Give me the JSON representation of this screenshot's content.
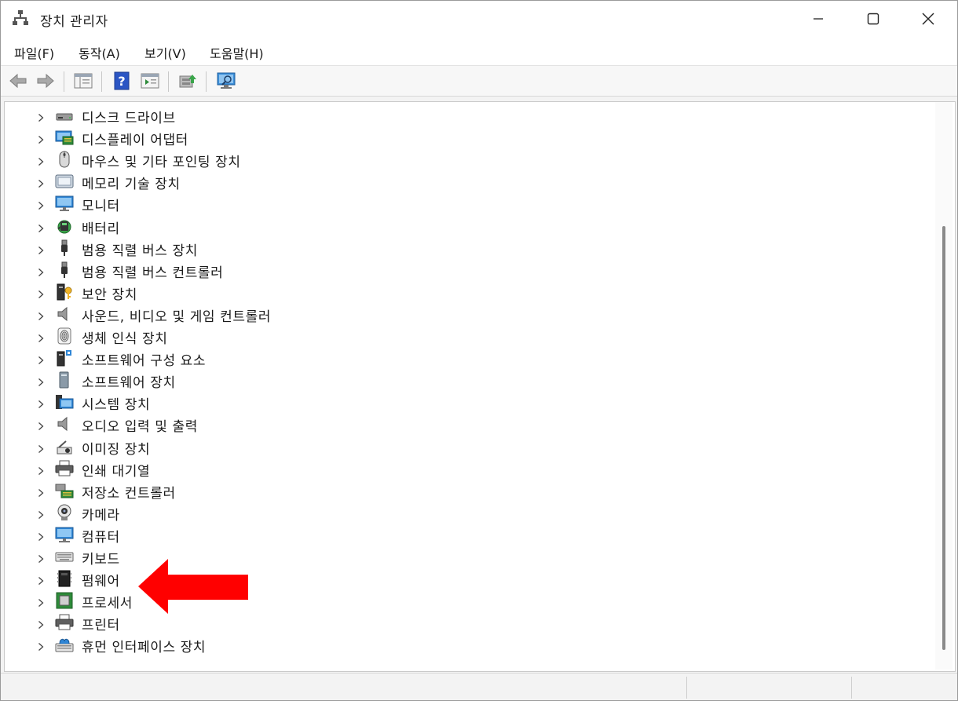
{
  "window": {
    "title": "장치 관리자"
  },
  "menu": [
    "파일(F)",
    "동작(A)",
    "보기(V)",
    "도움말(H)"
  ],
  "tree": [
    {
      "label": "디스크 드라이브",
      "icon": "disk-drive-icon"
    },
    {
      "label": "디스플레이 어댑터",
      "icon": "display-adapter-icon"
    },
    {
      "label": "마우스 및 기타 포인팅 장치",
      "icon": "mouse-icon"
    },
    {
      "label": "메모리 기술 장치",
      "icon": "memory-device-icon"
    },
    {
      "label": "모니터",
      "icon": "monitor-icon"
    },
    {
      "label": "배터리",
      "icon": "battery-icon"
    },
    {
      "label": "범용 직렬 버스 장치",
      "icon": "usb-icon"
    },
    {
      "label": "범용 직렬 버스 컨트롤러",
      "icon": "usb-icon"
    },
    {
      "label": "보안 장치",
      "icon": "security-device-icon"
    },
    {
      "label": "사운드, 비디오 및 게임 컨트롤러",
      "icon": "speaker-icon"
    },
    {
      "label": "생체 인식 장치",
      "icon": "fingerprint-icon"
    },
    {
      "label": "소프트웨어 구성 요소",
      "icon": "software-component-icon"
    },
    {
      "label": "소프트웨어 장치",
      "icon": "software-device-icon"
    },
    {
      "label": "시스템 장치",
      "icon": "system-device-icon"
    },
    {
      "label": "오디오 입력 및 출력",
      "icon": "speaker-icon"
    },
    {
      "label": "이미징 장치",
      "icon": "imaging-device-icon"
    },
    {
      "label": "인쇄 대기열",
      "icon": "printer-icon"
    },
    {
      "label": "저장소 컨트롤러",
      "icon": "storage-controller-icon"
    },
    {
      "label": "카메라",
      "icon": "camera-icon"
    },
    {
      "label": "컴퓨터",
      "icon": "computer-icon"
    },
    {
      "label": "키보드",
      "icon": "keyboard-icon"
    },
    {
      "label": "펌웨어",
      "icon": "firmware-icon"
    },
    {
      "label": "프로세서",
      "icon": "processor-icon"
    },
    {
      "label": "프린터",
      "icon": "printer-icon"
    },
    {
      "label": "휴먼 인터페이스 장치",
      "icon": "hid-icon"
    }
  ],
  "colors": {
    "annotation_arrow": "#ff0000",
    "accent": "#0b63c4"
  }
}
